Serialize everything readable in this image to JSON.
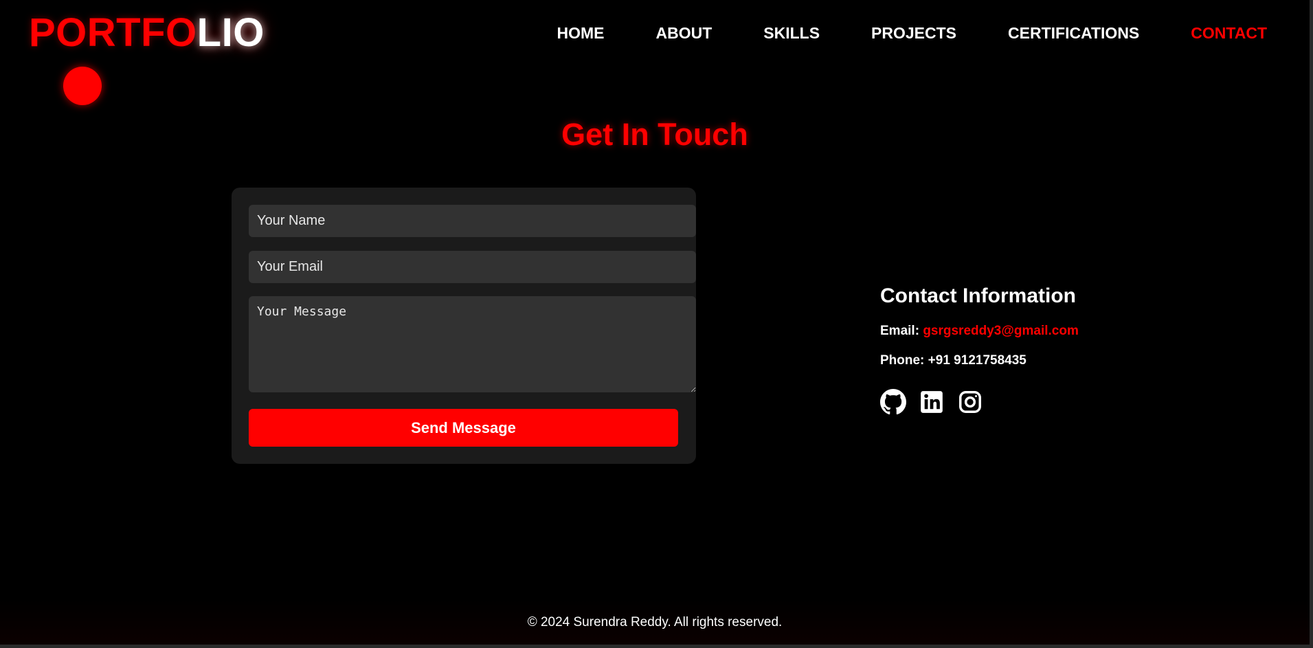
{
  "logo": {
    "part_red": "PORTFO",
    "part_white": "LIO"
  },
  "nav": {
    "items": [
      {
        "label": "HOME"
      },
      {
        "label": "ABOUT"
      },
      {
        "label": "SKILLS"
      },
      {
        "label": "PROJECTS"
      },
      {
        "label": "CERTIFICATIONS"
      },
      {
        "label": "CONTACT",
        "active": true
      }
    ]
  },
  "title": "Get In Touch",
  "form": {
    "name_placeholder": "Your Name",
    "email_placeholder": "Your Email",
    "message_placeholder": "Your Message",
    "submit_label": "Send Message"
  },
  "contact_info": {
    "title": "Contact Information",
    "email_label": "Email:",
    "email_value": "gsrgsreddy3@gmail.com",
    "phone_label": "Phone:",
    "phone_value": "+91 9121758435",
    "socials": [
      "github-icon",
      "linkedin-icon",
      "instagram-icon"
    ]
  },
  "footer": {
    "text": "© 2024 Surendra Reddy. All rights reserved."
  },
  "colors": {
    "accent": "#ff0000",
    "background": "#000000",
    "card": "#1b1b1b",
    "field": "#323232"
  }
}
